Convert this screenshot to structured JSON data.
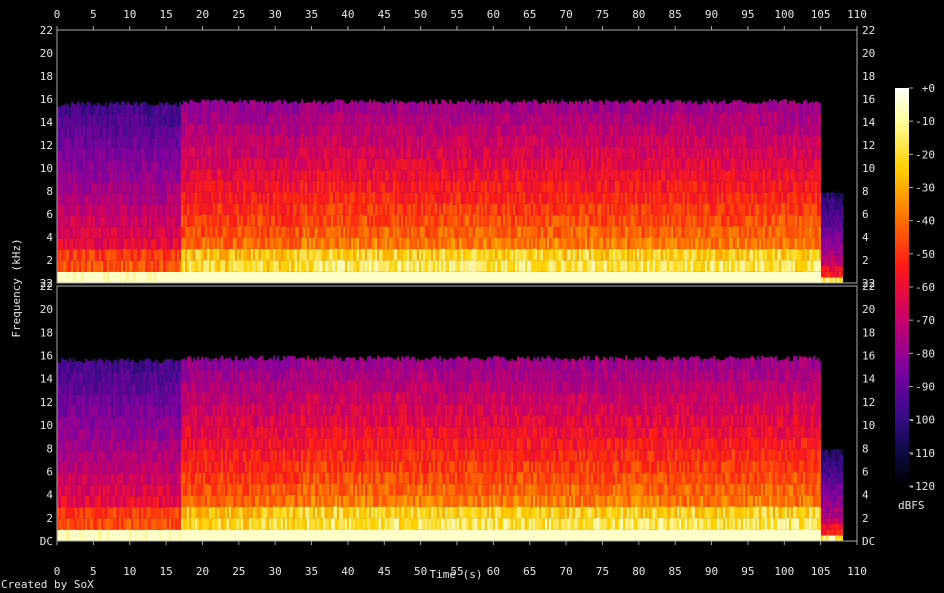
{
  "chart_data": {
    "type": "heatmap",
    "subtype": "spectrogram",
    "xlabel": "Time (s)",
    "ylabel": "Frequency (kHz)",
    "xlim": [
      0,
      110
    ],
    "ylim": [
      0,
      22
    ],
    "x_ticks": [
      "0",
      "5",
      "10",
      "15",
      "20",
      "25",
      "30",
      "35",
      "40",
      "45",
      "50",
      "55",
      "60",
      "65",
      "70",
      "75",
      "80",
      "85",
      "90",
      "95",
      "100",
      "105",
      "110"
    ],
    "y_ticks": [
      "DC",
      "2",
      "4",
      "6",
      "8",
      "10",
      "12",
      "14",
      "16",
      "18",
      "20",
      "22"
    ],
    "channels": [
      {
        "name": "",
        "y_bottom_label": "22"
      },
      {
        "name": "",
        "y_bottom_label": "DC"
      }
    ],
    "colorbar": {
      "label": "dBFS",
      "ticks": [
        "+0",
        "-10",
        "-20",
        "-30",
        "-40",
        "-50",
        "-60",
        "-70",
        "-80",
        "-90",
        "-100",
        "-110",
        "-120"
      ],
      "range": [
        -120,
        0
      ]
    },
    "segments": [
      {
        "t_start": 0,
        "t_end": 17,
        "cutoff_khz": 15.8,
        "level_db": -85
      },
      {
        "t_start": 17,
        "t_end": 33.5,
        "cutoff_khz": 16,
        "level_db": -65
      },
      {
        "t_start": 33.5,
        "t_end": 105,
        "cutoff_khz": 16,
        "level_db": -62
      },
      {
        "t_start": 105,
        "t_end": 108,
        "cutoff_khz": 8,
        "level_db": -95
      }
    ],
    "grid": false
  },
  "footer": {
    "credit": "Created by SoX"
  }
}
